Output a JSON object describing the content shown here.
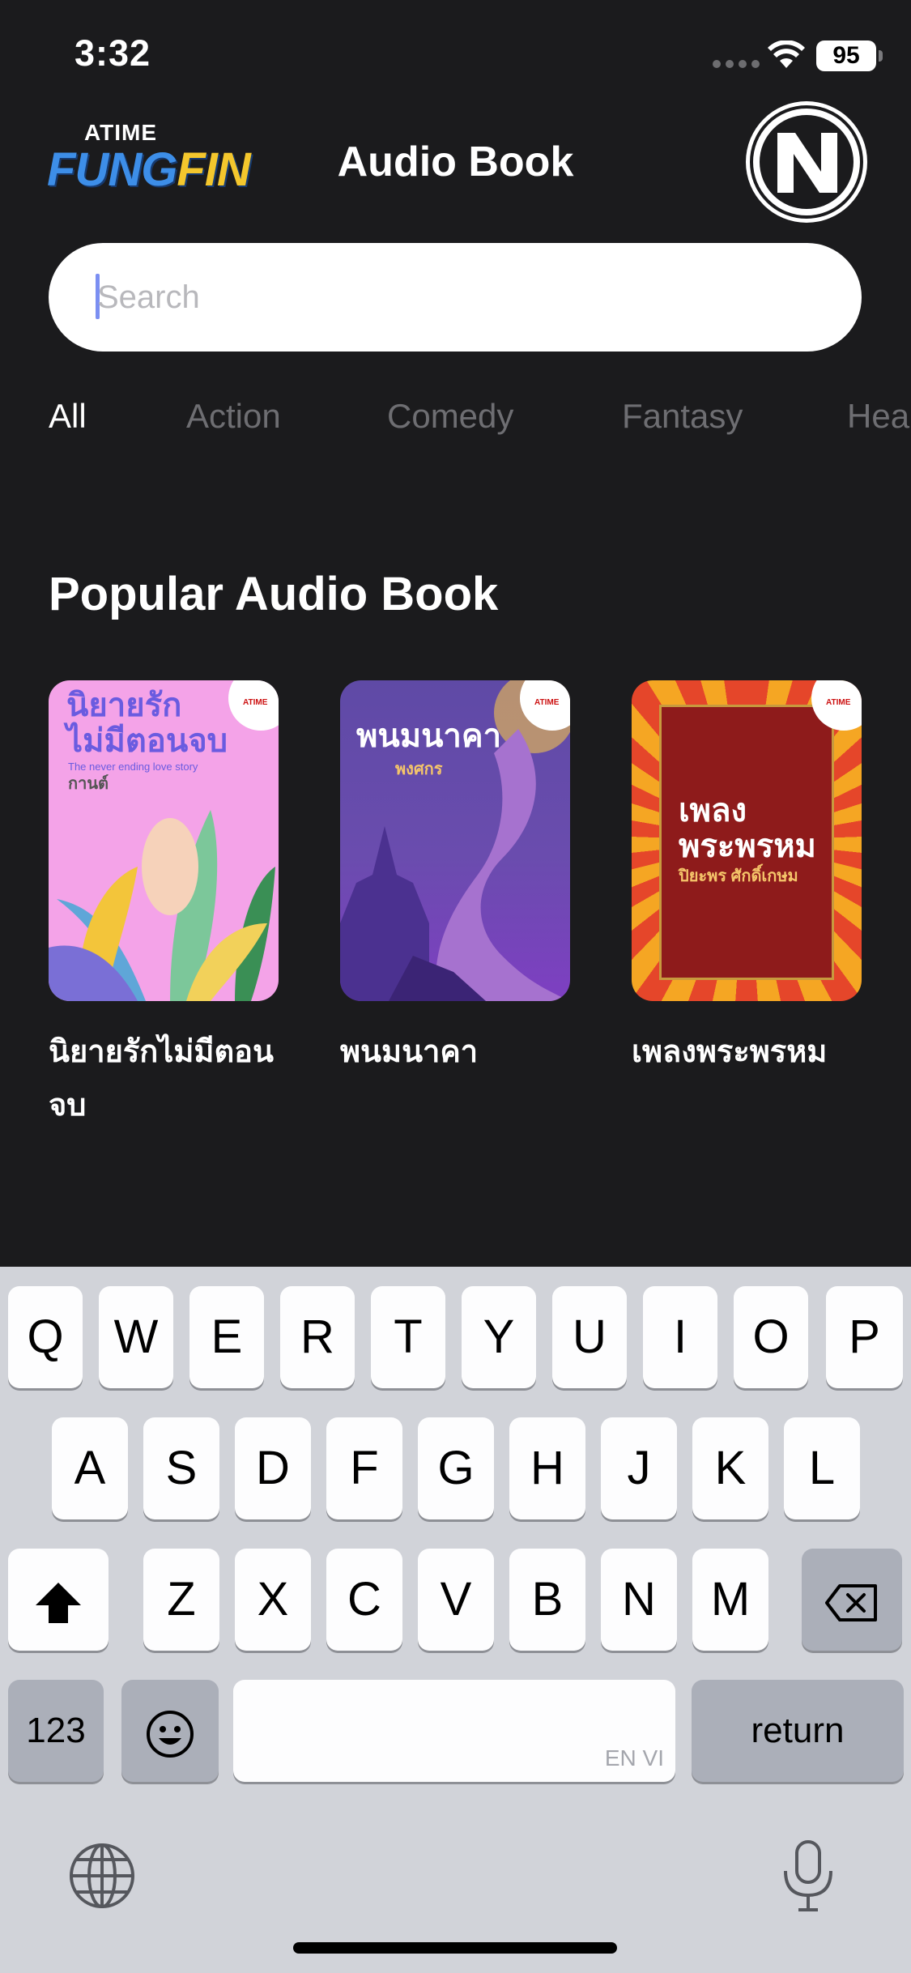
{
  "status_bar": {
    "time": "3:32",
    "battery": "95"
  },
  "header": {
    "logo_top": "ATIME",
    "logo_main_a": "FUNG",
    "logo_main_b": "FIN",
    "title": "Audio Book"
  },
  "search": {
    "placeholder": "Search"
  },
  "categories": [
    {
      "label": "All",
      "active": true
    },
    {
      "label": "Action",
      "active": false
    },
    {
      "label": "Comedy",
      "active": false
    },
    {
      "label": "Fantasy",
      "active": false
    },
    {
      "label": "Hea",
      "active": false
    }
  ],
  "popular": {
    "title": "Popular Audio Book",
    "books": [
      {
        "title": "นิยายรักไม่มีตอนจบ",
        "cover_line1": "นิยายรัก",
        "cover_line2": "ไม่มีตอนจบ",
        "cover_sub": "The never ending love story",
        "cover_author": "กานต์",
        "color": "#f4a3e8"
      },
      {
        "title": "พนมนาคา",
        "cover_line1": "พนมนาคา",
        "cover_author": "พงศกร",
        "color": "#6a4cae"
      },
      {
        "title": "เพลงพระพรหม",
        "cover_line1": "เพลง",
        "cover_line2": "พระพรหม",
        "cover_author": "ปิยะพร ศักดิ์เกษม",
        "color": "#8e1b1b"
      }
    ]
  },
  "keyboard": {
    "row1": [
      "Q",
      "W",
      "E",
      "R",
      "T",
      "Y",
      "U",
      "I",
      "O",
      "P"
    ],
    "row2": [
      "A",
      "S",
      "D",
      "F",
      "G",
      "H",
      "J",
      "K",
      "L"
    ],
    "row3": [
      "Z",
      "X",
      "C",
      "V",
      "B",
      "N",
      "M"
    ],
    "numbers_label": "123",
    "return_label": "return",
    "space_hint": "EN VI"
  },
  "colors": {
    "background": "#1b1b1d",
    "keyboard": "#d1d3d9",
    "accent_caret": "#7b8ff2"
  }
}
